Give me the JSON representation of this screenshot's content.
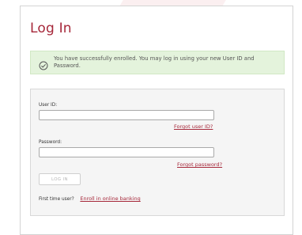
{
  "page": {
    "title": "Log In"
  },
  "alert": {
    "icon": "check-circle-icon",
    "message": "You have successfully enrolled. You may log in using your new User ID and Password."
  },
  "form": {
    "user_id_label": "User ID:",
    "user_id_value": "",
    "forgot_user_id": "Forgot user ID?",
    "password_label": "Password:",
    "password_value": "",
    "forgot_password": "Forgot password?",
    "login_button": "LOG IN",
    "first_time_text": "First time user?",
    "enroll_link": "Enroll in online banking"
  },
  "colors": {
    "brand": "#a6283a",
    "alert_bg": "#e4f3dc",
    "panel_bg": "#f5f5f5"
  }
}
